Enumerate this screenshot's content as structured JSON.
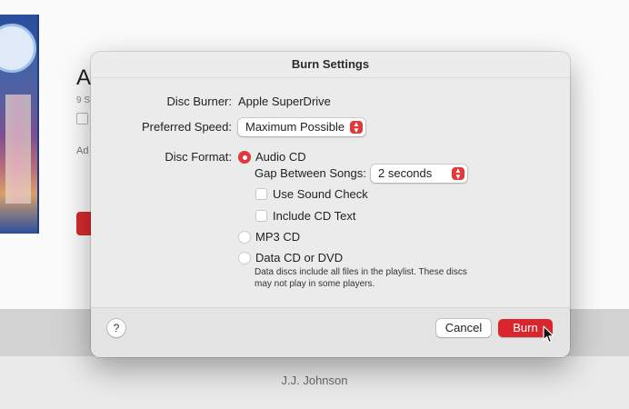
{
  "background": {
    "title_fragment": "A",
    "meta_fragment": "9 S",
    "add_fragment": "Ad",
    "artist": "J.J. Johnson"
  },
  "dialog": {
    "title": "Burn Settings",
    "disc_burner": {
      "label": "Disc Burner:",
      "value": "Apple SuperDrive"
    },
    "preferred_speed": {
      "label": "Preferred Speed:",
      "selected": "Maximum Possible"
    },
    "disc_format": {
      "label": "Disc Format:",
      "options": [
        {
          "label": "Audio CD",
          "selected": true
        },
        {
          "label": "MP3 CD",
          "selected": false
        },
        {
          "label": "Data CD or DVD",
          "selected": false
        }
      ],
      "gap_between_songs": {
        "label": "Gap Between Songs:",
        "selected": "2 seconds"
      },
      "use_sound_check": {
        "label": "Use Sound Check",
        "checked": false
      },
      "include_cd_text": {
        "label": "Include CD Text",
        "checked": false
      },
      "data_note": "Data discs include all files in the playlist. These discs may not play in some players."
    },
    "footer": {
      "help_label": "?",
      "cancel_label": "Cancel",
      "burn_label": "Burn"
    }
  },
  "icons": {
    "popup_chevron": "up-down-chevron-icon",
    "cursor": "arrow-cursor-icon"
  },
  "colors": {
    "accent": "#e0383b",
    "burn_button": "#d9262c",
    "dialog_bg": "#ececec"
  }
}
